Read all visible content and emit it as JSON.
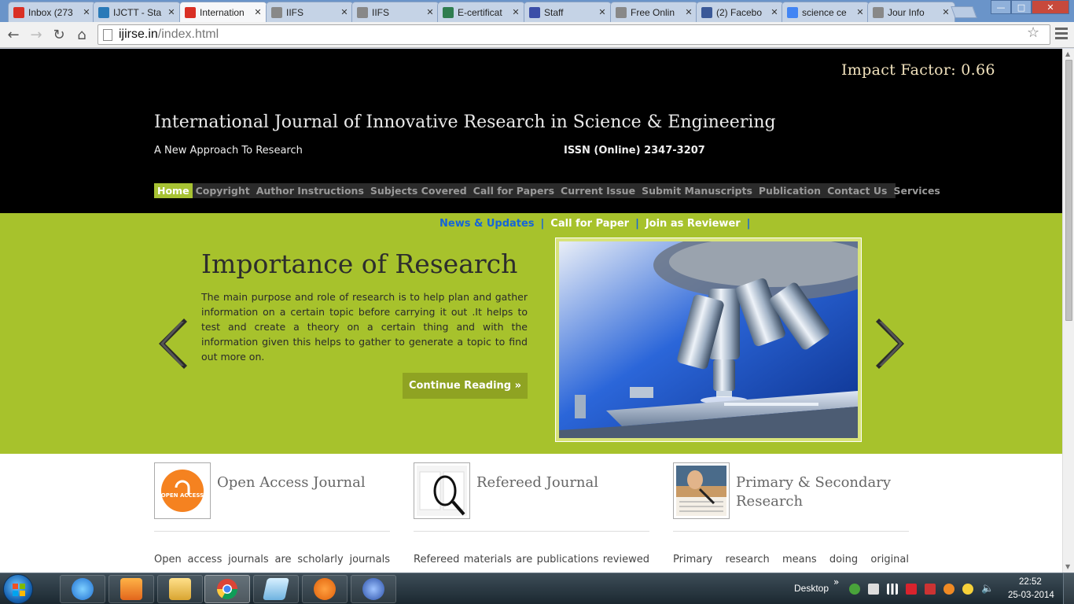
{
  "browser": {
    "tabs": [
      {
        "title": "Inbox (273",
        "favicon": "gmail-icon",
        "color": "#d93025"
      },
      {
        "title": "IJCTT - Sta",
        "favicon": "ijctt-icon",
        "color": "#2a7ab8"
      },
      {
        "title": "Internation",
        "favicon": "ijirse-icon",
        "color": "#d93025",
        "active": true
      },
      {
        "title": "IIFS",
        "favicon": "page-icon",
        "color": "#888888"
      },
      {
        "title": "IIFS",
        "favicon": "page-icon",
        "color": "#888888"
      },
      {
        "title": "E-certificat",
        "favicon": "certificate-icon",
        "color": "#2f7d4f"
      },
      {
        "title": "Staff",
        "favicon": "staff-icon",
        "color": "#3b4ea8"
      },
      {
        "title": "Free Onlin",
        "favicon": "page-icon",
        "color": "#888888"
      },
      {
        "title": "(2) Facebo",
        "favicon": "facebook-icon",
        "color": "#3b5998"
      },
      {
        "title": "science ce",
        "favicon": "google-icon",
        "color": "#4285f4"
      },
      {
        "title": "Jour Info",
        "favicon": "page-icon",
        "color": "#888888"
      }
    ],
    "url_host": "ijirse.in",
    "url_path": "/index.html"
  },
  "site": {
    "impact_factor": "Impact Factor: 0.66",
    "title": "International Journal of Innovative Research in Science & Engineering",
    "tagline": "A New Approach To Research",
    "issn": "ISSN (Online) 2347-3207",
    "nav": [
      "Home",
      "Copyright",
      "Author Instructions",
      "Subjects Covered",
      "Call for Papers",
      "Current Issue",
      "Submit Manuscripts",
      "Publication",
      "Contact Us",
      "Services"
    ],
    "nav_active": "Home",
    "news_links": [
      "News & Updates",
      "Call for Paper",
      "Join as Reviewer"
    ],
    "news_separator": "|",
    "slide": {
      "title": "Importance of Research",
      "text": "The main purpose and role of research is to help plan and gather information on a certain topic before carrying it out .It helps to test and create a theory on a certain thing and with the information given this helps to gather to generate a topic to find out more on.",
      "button": "Continue Reading »",
      "image": "microscope-image"
    },
    "features": [
      {
        "title": "Open Access Journal",
        "thumb": "open-access-logo",
        "thumb_text": "OPEN ACCESS",
        "text": "Open access journals are scholarly journals"
      },
      {
        "title": "Refereed Journal",
        "thumb": "magnifier-thumb",
        "text": "Refereed materials are publications reviewed"
      },
      {
        "title": "Primary & Secondary Research",
        "thumb": "writing-thumb",
        "text": "Primary research means doing original"
      }
    ],
    "colors": {
      "header_bg": "#000000",
      "accent_green": "#a7c22c",
      "nav_active": "#a7c233",
      "link_blue": "#1565d8"
    }
  },
  "taskbar": {
    "apps": [
      "internet-explorer-icon",
      "media-player-icon",
      "file-explorer-icon",
      "chrome-icon",
      "notepad-icon",
      "avast-icon",
      "thunderbird-icon"
    ],
    "desktop_label": "Desktop",
    "time": "22:52",
    "date": "25-03-2014"
  }
}
